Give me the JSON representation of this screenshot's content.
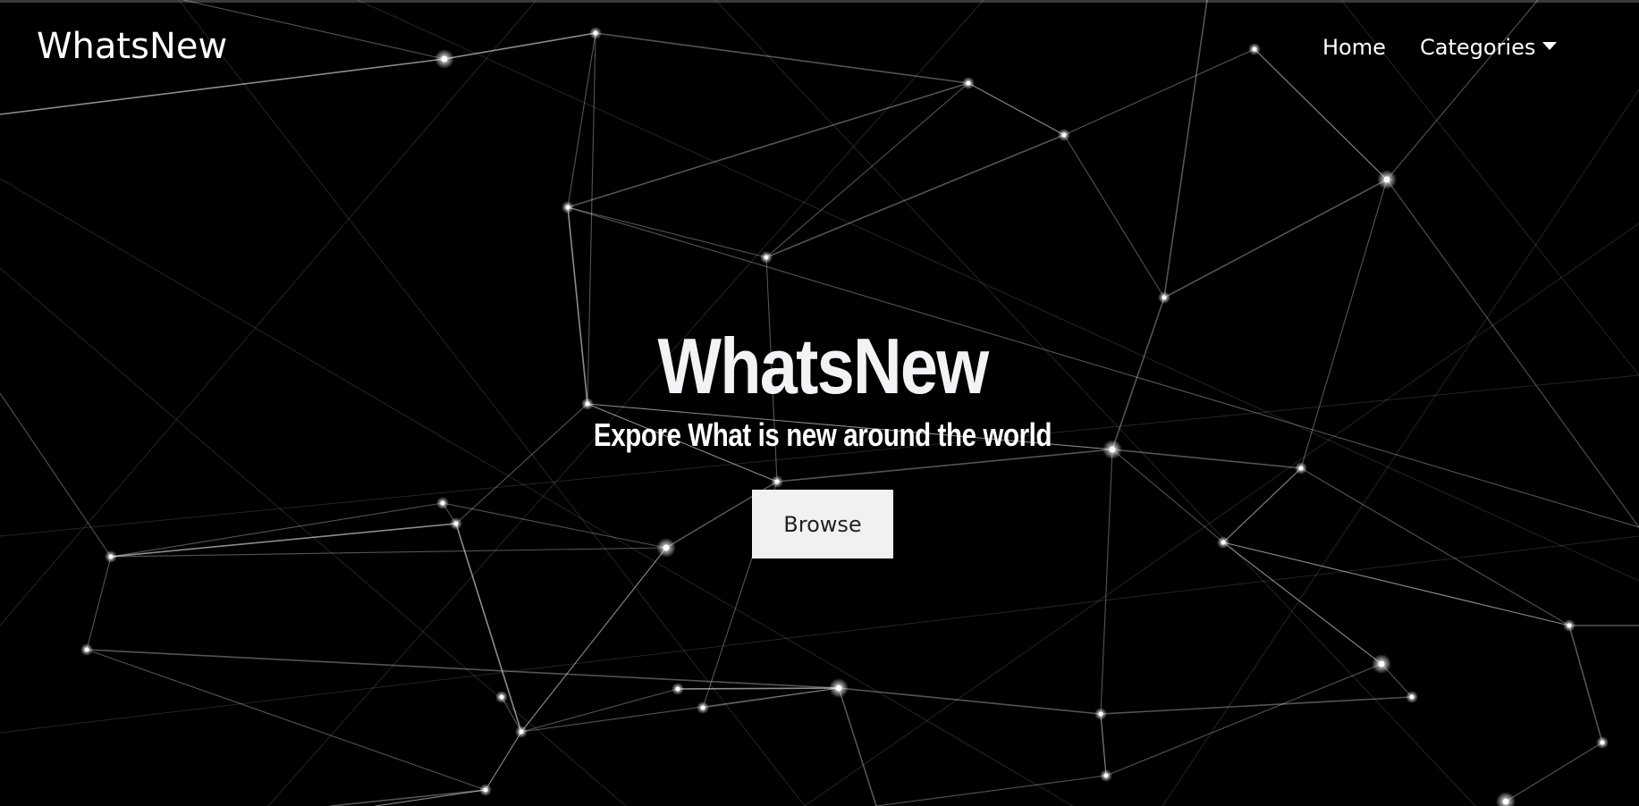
{
  "navbar": {
    "brand": "WhatsNew",
    "links": [
      {
        "label": "Home"
      },
      {
        "label": "Categories"
      }
    ]
  },
  "hero": {
    "title": "WhatsNew",
    "subtitle": "Expore What is new around the world",
    "button_label": "Browse"
  },
  "colors": {
    "background": "#000000",
    "text": "#ffffff",
    "button_bg": "#f1f1f1",
    "button_text": "#222222"
  },
  "icons": {
    "dropdown": "caret-down-icon"
  }
}
